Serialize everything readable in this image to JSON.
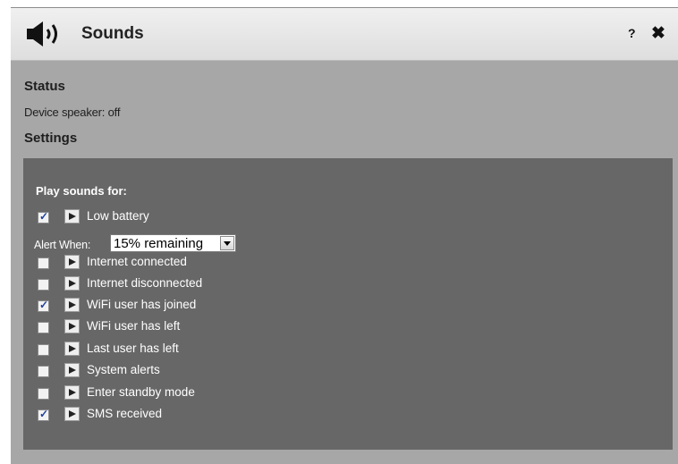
{
  "header": {
    "title": "Sounds",
    "help_label": "?",
    "close_label": "✖"
  },
  "status": {
    "heading": "Status",
    "device_speaker": "Device speaker: off"
  },
  "settings": {
    "heading": "Settings",
    "play_sounds_for": "Play sounds for:",
    "alert_when_label": "Alert When:",
    "alert_when_value": "15% remaining",
    "items": [
      {
        "label": "Low battery",
        "checked": true
      },
      {
        "label": "Internet connected",
        "checked": false
      },
      {
        "label": "Internet disconnected",
        "checked": false
      },
      {
        "label": "WiFi user has joined",
        "checked": true
      },
      {
        "label": "WiFi user has left",
        "checked": false
      },
      {
        "label": "Last user has left",
        "checked": false
      },
      {
        "label": "System alerts",
        "checked": false
      },
      {
        "label": "Enter standby mode",
        "checked": false
      },
      {
        "label": "SMS received",
        "checked": true
      }
    ]
  },
  "icons": {
    "speaker": "speaker-icon",
    "play": "play-icon",
    "dropdown": "chevron-down-icon",
    "checkmark": "check-icon"
  }
}
